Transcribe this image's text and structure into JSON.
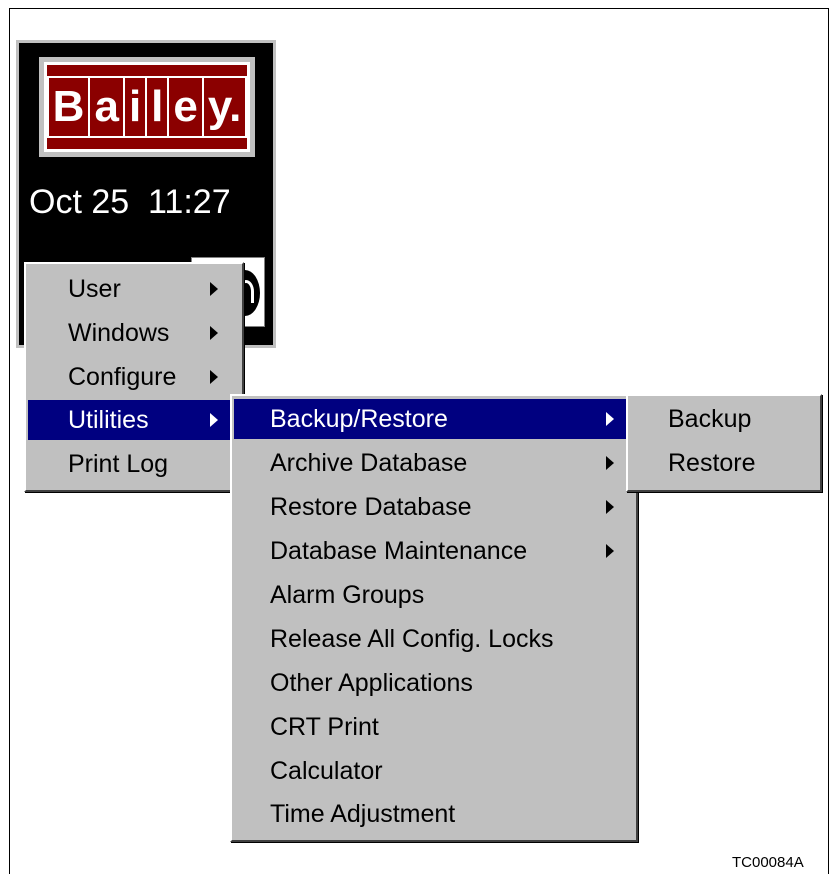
{
  "logo": {
    "letters": [
      "B",
      "a",
      "i",
      "l",
      "e",
      "y."
    ]
  },
  "clock": {
    "text": "Oct 25  11:27"
  },
  "main_menu": {
    "items": [
      {
        "label": "User",
        "submenu": true
      },
      {
        "label": "Windows",
        "submenu": true
      },
      {
        "label": "Configure",
        "submenu": true
      },
      {
        "label": "Utilities",
        "submenu": true,
        "active": true
      },
      {
        "label": "Print Log",
        "submenu": false
      }
    ]
  },
  "utilities_menu": {
    "items": [
      {
        "label": "Backup/Restore",
        "submenu": true,
        "active": true
      },
      {
        "label": "Archive Database",
        "submenu": true
      },
      {
        "label": "Restore Database",
        "submenu": true
      },
      {
        "label": "Database Maintenance",
        "submenu": true
      },
      {
        "label": "Alarm Groups",
        "submenu": false
      },
      {
        "label": "Release All Config. Locks",
        "submenu": false
      },
      {
        "label": "Other Applications",
        "submenu": false
      },
      {
        "label": "CRT Print",
        "submenu": false
      },
      {
        "label": "Calculator",
        "submenu": false
      },
      {
        "label": "Time Adjustment",
        "submenu": false
      }
    ]
  },
  "backup_menu": {
    "items": [
      {
        "label": "Backup"
      },
      {
        "label": "Restore"
      }
    ]
  },
  "figure_id": "TC00084A",
  "colors": {
    "highlight": "#000080",
    "menu_bg": "#c0c0c0",
    "logo_bg": "#8b0000"
  }
}
